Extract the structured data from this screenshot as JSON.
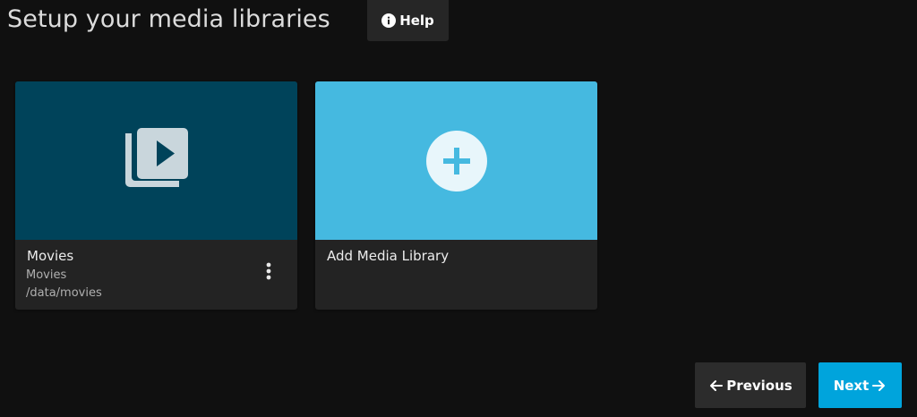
{
  "page": {
    "title": "Setup your media libraries"
  },
  "header": {
    "help_label": "Help",
    "help_icon": "info-icon"
  },
  "libraries": [
    {
      "name": "Movies",
      "type": "Movies",
      "path": "/data/movies",
      "icon": "video-library-icon",
      "image_color": "#00435a",
      "menu_icon": "more-vertical-icon"
    }
  ],
  "add_library": {
    "label": "Add Media Library",
    "icon": "plus-circle-icon",
    "image_color": "#45b9e0"
  },
  "navigation": {
    "previous_label": "Previous",
    "previous_icon": "arrow-left-icon",
    "next_label": "Next",
    "next_icon": "arrow-right-icon",
    "accent_color": "#00a4dc"
  }
}
